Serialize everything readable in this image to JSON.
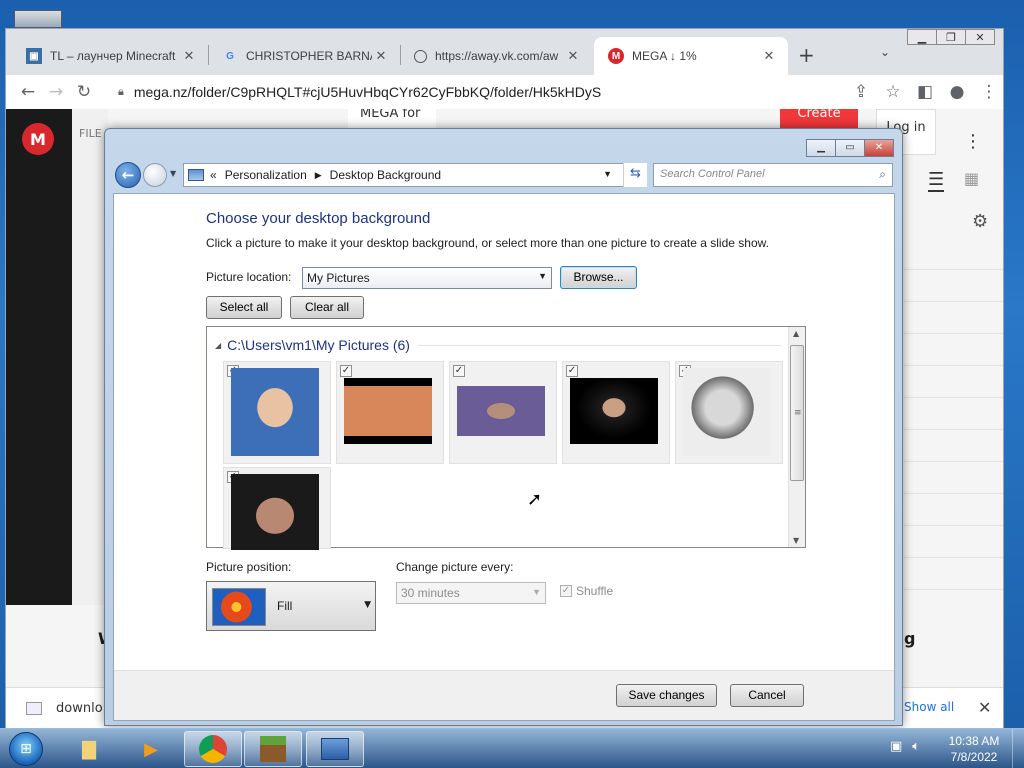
{
  "browser": {
    "tabs": [
      {
        "label": "TL – лаунчер Minecraft",
        "close": "✕"
      },
      {
        "label": "CHRISTOPHER BARNATT",
        "close": "✕"
      },
      {
        "label": "https://away.vk.com/aw",
        "close": "✕"
      },
      {
        "label": "MEGA ↓ 1%",
        "close": "✕"
      }
    ],
    "new_tab": "+",
    "url": "mega.nz/folder/C9pRHQLT#cjU5HuvHbqCYr62CyFbbKQ/folder/Hk5kHDyS"
  },
  "mega_page": {
    "logo": "M",
    "file_label": "FILE",
    "mega_for": "MEGA for",
    "create": "Create",
    "login": "Log in",
    "download_name": "downlo",
    "show_all": "Show all",
    "partial_left": "W",
    "partial_right": "g"
  },
  "control_panel": {
    "breadcrumb": [
      "Personalization",
      "Desktop Background"
    ],
    "search_placeholder": "Search Control Panel",
    "title": "Choose your desktop background",
    "description": "Click a picture to make it your desktop background, or select more than one picture to create a slide show.",
    "picture_location_label": "Picture location:",
    "picture_location_value": "My Pictures",
    "browse": "Browse...",
    "select_all": "Select all",
    "clear_all": "Clear all",
    "group_header": "C:\\Users\\vm1\\My Pictures (6)",
    "pictures_checked": [
      true,
      true,
      true,
      true,
      true,
      true
    ],
    "picture_position_label": "Picture position:",
    "picture_position_value": "Fill",
    "change_every_label": "Change picture every:",
    "change_every_value": "30 minutes",
    "shuffle": "Shuffle",
    "shuffle_checked": true,
    "save": "Save changes",
    "cancel": "Cancel"
  },
  "taskbar": {
    "time": "10:38 AM",
    "date": "7/8/2022"
  },
  "colors": {
    "mega_red": "#d9272e",
    "cp_title_blue": "#1e3287",
    "taskbar": "#2d5587"
  }
}
